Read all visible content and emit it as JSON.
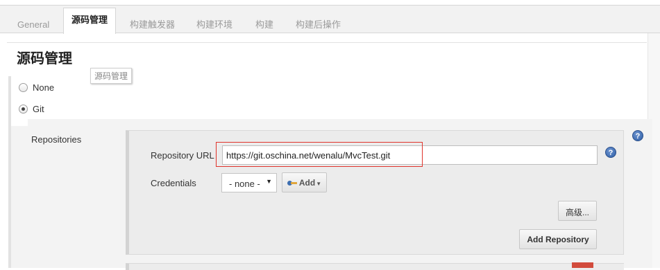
{
  "tabs": [
    {
      "label": "General",
      "active": false
    },
    {
      "label": "源码管理",
      "active": true
    },
    {
      "label": "构建触发器",
      "active": false
    },
    {
      "label": "构建环境",
      "active": false
    },
    {
      "label": "构建",
      "active": false
    },
    {
      "label": "构建后操作",
      "active": false
    }
  ],
  "section": {
    "title": "源码管理",
    "tooltip": "源码管理",
    "scm_options": [
      {
        "label": "None",
        "selected": false
      },
      {
        "label": "Git",
        "selected": true
      }
    ]
  },
  "git": {
    "repositories_label": "Repositories",
    "repository_url_label": "Repository URL",
    "repository_url_value": "https://git.oschina.net/wenalu/MvcTest.git",
    "credentials_label": "Credentials",
    "credentials_selected": "- none -",
    "add_button_label": "Add",
    "advanced_button_label": "高级...",
    "add_repository_button_label": "Add Repository"
  },
  "icons": {
    "help": "help-icon",
    "key": "key-icon",
    "dropdown": "chevron-down-icon"
  },
  "colors": {
    "highlight_border": "#e0322a",
    "help_icon": "#2c5da6",
    "tab_bar": "#f2f2f2",
    "panel": "#f3f3f3"
  }
}
